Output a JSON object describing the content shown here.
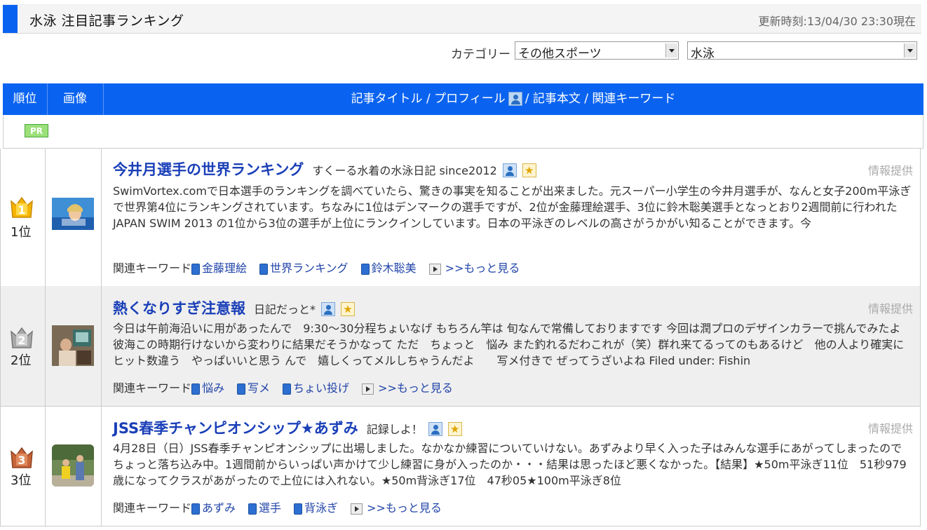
{
  "header": {
    "title": "水泳 注目記事ランキング",
    "updated": "更新時刻:13/04/30 23:30現在"
  },
  "filters": {
    "category_label": "カテゴリー",
    "category_value": "その他スポーツ",
    "subcategory_value": "水泳"
  },
  "table": {
    "col_rank": "順位",
    "col_image": "画像",
    "col_main_a": "記事タイトル / プロフィール",
    "col_main_b": "/ 記事本文 / 関連キーワード",
    "pr_label": "PR"
  },
  "common": {
    "info_label": "情報提供",
    "keywords_label": "関連キーワード",
    "more_label": ">>もっと見る"
  },
  "articles": [
    {
      "rank": "1位",
      "title": "今井月選手の世界ランキング",
      "blog": "すくーる水着の水泳日記 since2012",
      "body": "SwimVortex.comで日本選手のランキングを調べていたら、驚きの事実を知ることが出来ました。元スーパー小学生の今井月選手が、なんと女子200m平泳ぎで世界第4位にランキングされています。ちなみに1位はデンマークの選手ですが、2位が金藤理絵選手、3位に鈴木聡美選手となっとおり2週間前に行われたJAPAN SWIM 2013 の1位から3位の選手が上位にランクインしています。日本の平泳ぎのレベルの高さがうかがい知ることができます。今",
      "keywords": [
        "金藤理絵",
        "世界ランキング",
        "鈴木聡美"
      ]
    },
    {
      "rank": "2位",
      "title": "熱くなりすぎ注意報",
      "blog": "日記だっと*",
      "body": "今日は午前海沿いに用があったんで　9:30～30分程ちょいなげ もちろん竿は 旬なんで常備しておりますです 今回は潤プロのデザインカラーで挑んでみたよ 彼海この時期行けないから変わりに結果だそうかなって ただ　ちょっと　悩み また釣れるだわこれが（笑）群れ来てるってのもあるけど　他の人より確実にヒット数違う　やっぱいいと思う んで　嬉しくってメルしちゃうんだよ　　写メ付きで ぜってうざいよね Filed under: Fishin",
      "keywords": [
        "悩み",
        "写メ",
        "ちょい投げ"
      ]
    },
    {
      "rank": "3位",
      "title": "JSS春季チャンピオンシップ★あずみ",
      "blog": "記録しよ！",
      "body": "4月28日（日）JSS春季チャンピオンシップに出場しました。なかなか練習についていけない。あずみより早く入った子はみんな選手にあがってしまったのでちょっと落ち込み中。1週間前からいっぱい声かけて少し練習に身が入ったのか・・・結果は思ったほど悪くなかった。【結果】★50m平泳ぎ11位　51秒979歳になってクラスがあがったので上位には入れない。★50m背泳ぎ17位　47秒05★100m平泳ぎ8位",
      "keywords": [
        "あずみ",
        "選手",
        "背泳ぎ"
      ]
    }
  ]
}
